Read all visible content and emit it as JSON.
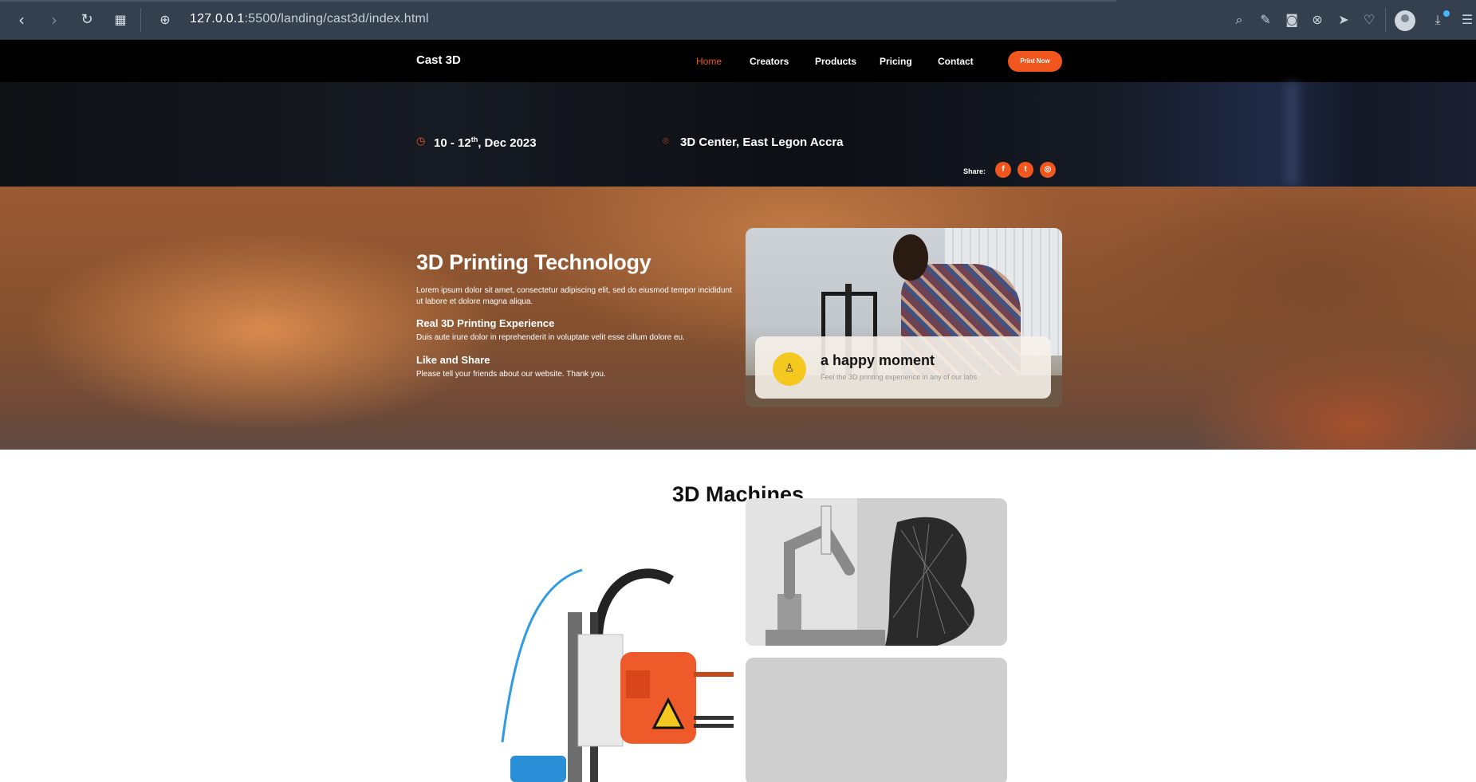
{
  "browser": {
    "url_host": "127.0.0.1",
    "url_rest": ":5500/landing/cast3d/index.html",
    "icons": [
      "back-icon",
      "forward-icon",
      "reload-icon",
      "apps-icon",
      "site-info-icon"
    ],
    "right_icons": [
      "search-icon",
      "edit-icon",
      "camera-icon",
      "close-icon",
      "send-icon",
      "heart-icon",
      "profile-icon",
      "download-icon",
      "menu-icon"
    ]
  },
  "nav": {
    "brand": "Cast 3D",
    "links": [
      "Home",
      "Creators",
      "Products",
      "Pricing",
      "Contact"
    ],
    "active": "Home",
    "cta": "Print Now",
    "accent": "#f0561d"
  },
  "event": {
    "date_prefix": "10 - 12",
    "date_sup": "th",
    "date_suffix": ", Dec 2023",
    "location": "3D Center, East Legon Accra",
    "share_label": "Share:",
    "socials": [
      "facebook-icon",
      "twitter-icon",
      "instagram-icon"
    ]
  },
  "hero": {
    "title": "3D Printing Technology",
    "intro": "Lorem ipsum dolor sit amet, consectetur adipiscing elit, sed do eiusmod tempor incididunt ut labore et dolore magna aliqua.",
    "feature1_title": "Real 3D Printing Experience",
    "feature1_text": "Duis aute irure dolor in reprehenderit in voluptate velit esse cillum dolore eu.",
    "feature2_title": "Like and Share",
    "feature2_text": "Please tell your friends about our website. Thank you.",
    "card_title": "a happy moment",
    "card_text": "Feel the 3D printing experience in any of our labs"
  },
  "machines": {
    "title": "3D Machines"
  }
}
